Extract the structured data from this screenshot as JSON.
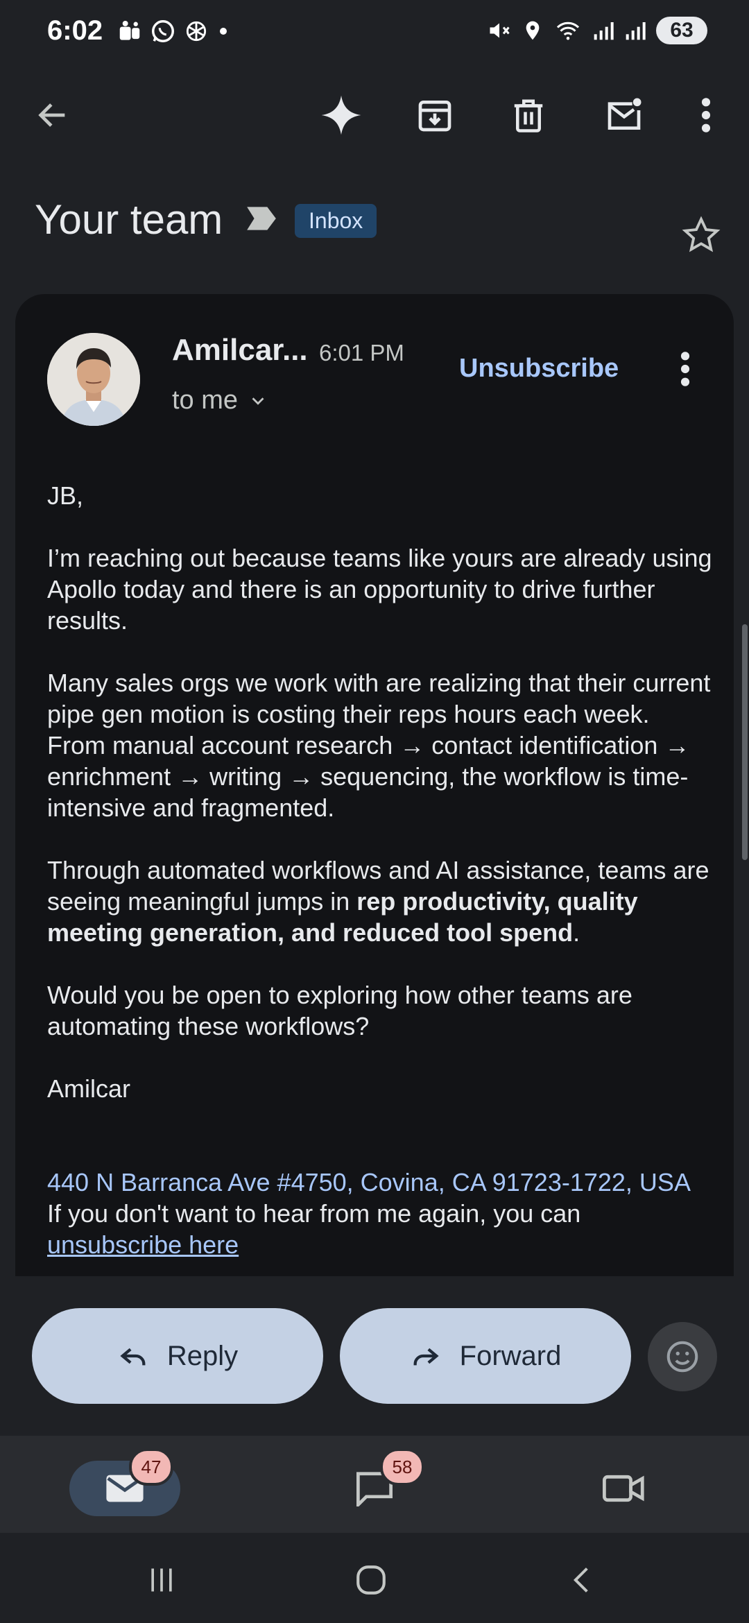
{
  "status_bar": {
    "time": "6:02",
    "battery": "63",
    "icons_left": [
      "teams-icon",
      "whatsapp-icon",
      "chatgpt-icon",
      "dot-icon"
    ],
    "icons_right": [
      "mute-icon",
      "location-icon",
      "wifi-icon",
      "signal-icon",
      "signal-icon"
    ]
  },
  "toolbar": {
    "icons": [
      "back-icon",
      "gemini-icon",
      "archive-icon",
      "delete-icon",
      "mark-unread-icon",
      "more-icon"
    ]
  },
  "subject": {
    "text": "Your team",
    "label": "Inbox"
  },
  "email": {
    "sender": "Amilcar...",
    "time": "6:01 PM",
    "recipient": "to me",
    "unsubscribe": "Unsubscribe",
    "greeting": "JB,",
    "p1": "I’m reaching out because teams like yours are already using Apollo today and there is an opportunity to drive further results.",
    "p2": "Many sales orgs we work with are realizing that their current pipe gen motion is costing their reps hours each week. From manual account research → contact identification → enrichment → writing → sequencing, the workflow is time-intensive and fragmented.",
    "p3_start": "Through automated workflows and AI assistance, teams are seeing meaningful jumps in ",
    "p3_bold": "rep productivity, quality meeting generation, and reduced tool spend",
    "p3_end": ".",
    "p4": "Would you be open to exploring how other teams are automating these workflows?",
    "signature": "Amilcar",
    "address": "440 N Barranca Ave #4750, Covina, CA 91723-1722, USA",
    "footer": "If you don't want to hear from me again, you can",
    "footer_link": "unsubscribe here"
  },
  "actions": {
    "reply": "Reply",
    "forward": "Forward"
  },
  "bottom_nav": {
    "mail_badge": "47",
    "chat_badge": "58"
  },
  "colors": {
    "background": "#1f2125",
    "card": "#121316",
    "link": "#a8c7fa",
    "pill": "#c4d1e4",
    "badge": "#f2b8b5"
  }
}
